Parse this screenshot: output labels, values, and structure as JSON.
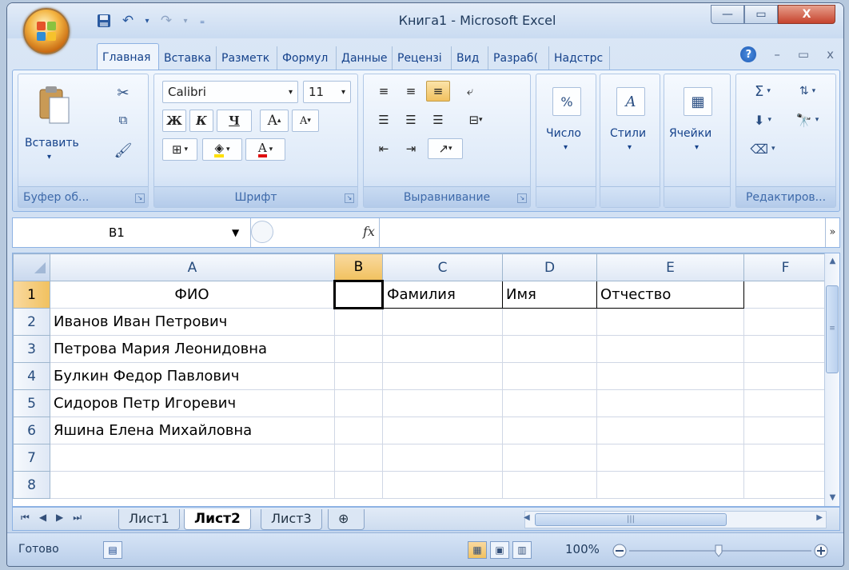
{
  "window": {
    "title": "Книга1 - Microsoft Excel",
    "min_label": "—",
    "max_label": "▭",
    "close_label": "X"
  },
  "qat": {
    "save_icon": "floppy-disk-icon",
    "undo_icon": "undo-icon",
    "redo_icon": "redo-icon"
  },
  "tabs": [
    {
      "label": "Главная",
      "active": true
    },
    {
      "label": "Вставка"
    },
    {
      "label": "Разметк"
    },
    {
      "label": "Формул"
    },
    {
      "label": "Данные"
    },
    {
      "label": "Рецензі"
    },
    {
      "label": "Вид"
    },
    {
      "label": "Разраб("
    },
    {
      "label": "Надстрс"
    }
  ],
  "ribbon": {
    "clipboard": {
      "label": "Буфер об...",
      "paste": "Вставить"
    },
    "font": {
      "label": "Шрифт",
      "family": "Calibri",
      "size": "11",
      "bold": "Ж",
      "italic": "К",
      "underline": "Ч",
      "grow": "A",
      "shrink": "A"
    },
    "alignment": {
      "label": "Выравнивание"
    },
    "number": {
      "label": "Число",
      "icon_text": "%"
    },
    "styles": {
      "label": "Стили"
    },
    "cells": {
      "label": "Ячейки"
    },
    "editing": {
      "label": "Редактиров...",
      "sum": "Σ"
    }
  },
  "formula_bar": {
    "name_box": "B1",
    "fx": "fx",
    "value": ""
  },
  "grid": {
    "columns": [
      "A",
      "B",
      "C",
      "D",
      "E",
      "F"
    ],
    "selected_column": "B",
    "rows": [
      {
        "n": "1",
        "cells": [
          "ФИО",
          "",
          "Фамилия",
          "Имя",
          "Отчество",
          ""
        ]
      },
      {
        "n": "2",
        "cells": [
          "Иванов Иван Петрович",
          "",
          "",
          "",
          "",
          ""
        ]
      },
      {
        "n": "3",
        "cells": [
          "Петрова Мария Леонидовна",
          "",
          "",
          "",
          "",
          ""
        ]
      },
      {
        "n": "4",
        "cells": [
          "Булкин Федор Павлович",
          "",
          "",
          "",
          "",
          ""
        ]
      },
      {
        "n": "5",
        "cells": [
          "Сидоров Петр Игоревич",
          "",
          "",
          "",
          "",
          ""
        ]
      },
      {
        "n": "6",
        "cells": [
          "Яшина Елена Михайловна",
          "",
          "",
          "",
          "",
          ""
        ]
      },
      {
        "n": "7",
        "cells": [
          "",
          "",
          "",
          "",
          "",
          ""
        ]
      },
      {
        "n": "8",
        "cells": [
          "",
          "",
          "",
          "",
          "",
          ""
        ]
      }
    ]
  },
  "sheets": [
    {
      "label": "Лист1"
    },
    {
      "label": "Лист2",
      "active": true
    },
    {
      "label": "Лист3"
    }
  ],
  "status": {
    "ready": "Готово",
    "zoom": "100%"
  }
}
